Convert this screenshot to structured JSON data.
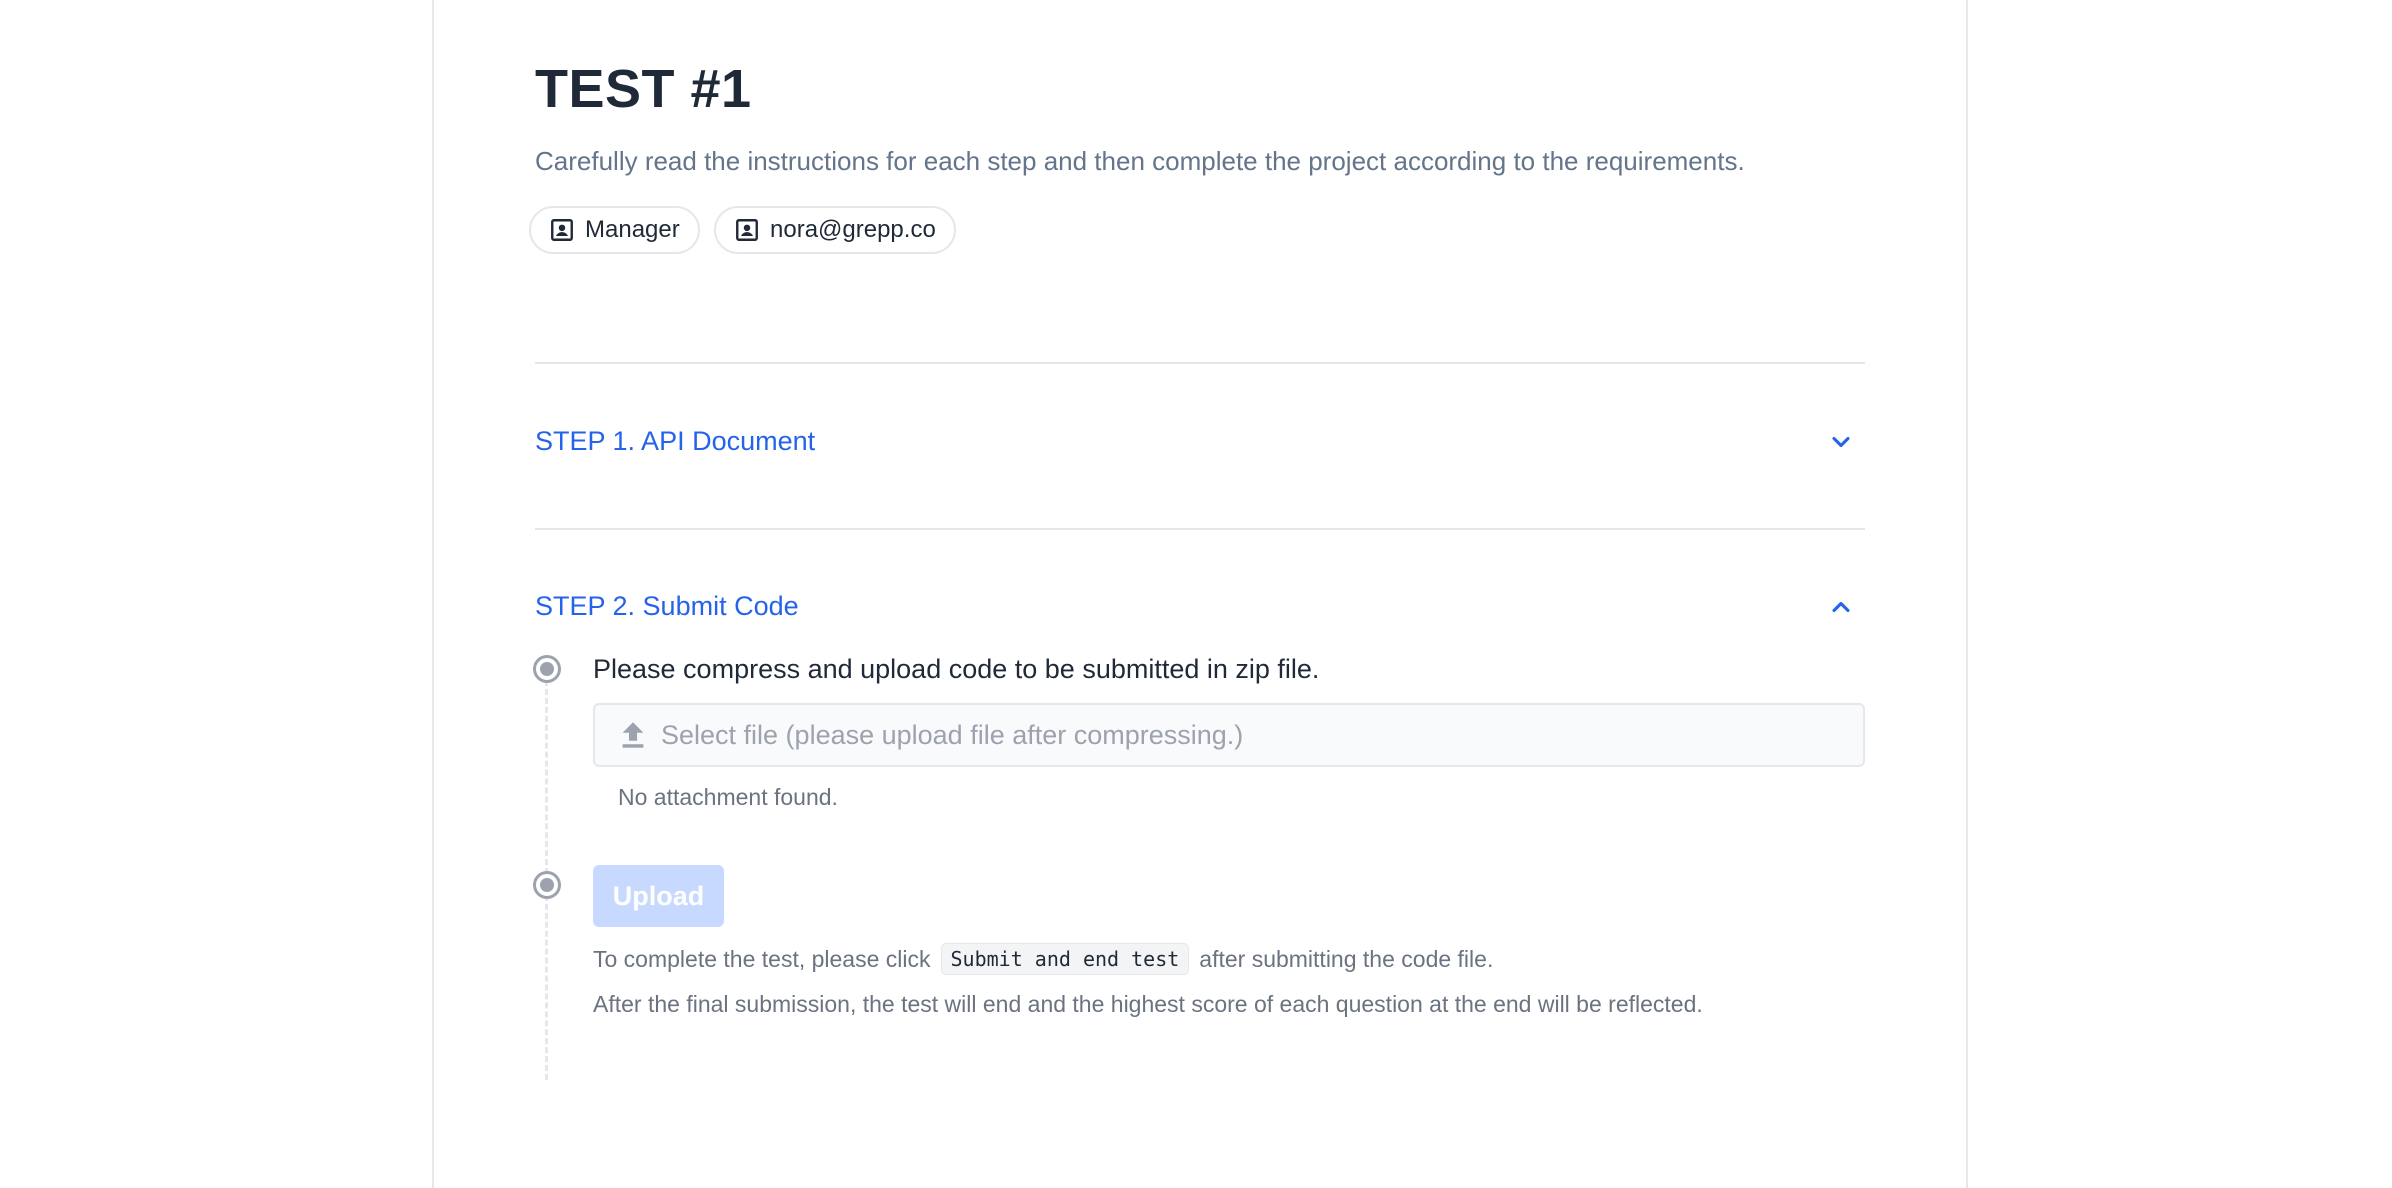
{
  "header": {
    "title": "TEST #1",
    "description": "Carefully read the instructions for each step and then complete the project according to the requirements."
  },
  "chips": [
    {
      "label": "Manager",
      "icon": "contact-card-icon"
    },
    {
      "label": "nora@grepp.co",
      "icon": "contact-card-icon"
    }
  ],
  "steps": [
    {
      "label": "STEP 1. API Document",
      "expanded": false,
      "toggle_icon": "chevron-down-icon"
    },
    {
      "label": "STEP 2. Submit Code",
      "expanded": true,
      "toggle_icon": "chevron-up-icon"
    }
  ],
  "submit": {
    "instruction": "Please compress and upload code to be submitted in zip file.",
    "file_placeholder": "Select file (please upload file after compressing.)",
    "no_attachment": "No attachment found.",
    "upload_label": "Upload",
    "note_prefix": "To complete the test, please click",
    "note_code": "Submit and end test",
    "note_suffix": "after submitting the code file.",
    "final_note": "After the final submission, the test will end and the highest score of each question at the end will be reflected."
  },
  "colors": {
    "accent": "#2563eb",
    "title": "#1f2937",
    "muted": "#6b7280",
    "upload_disabled": "#c7d9fe",
    "border": "#e5e7eb"
  }
}
